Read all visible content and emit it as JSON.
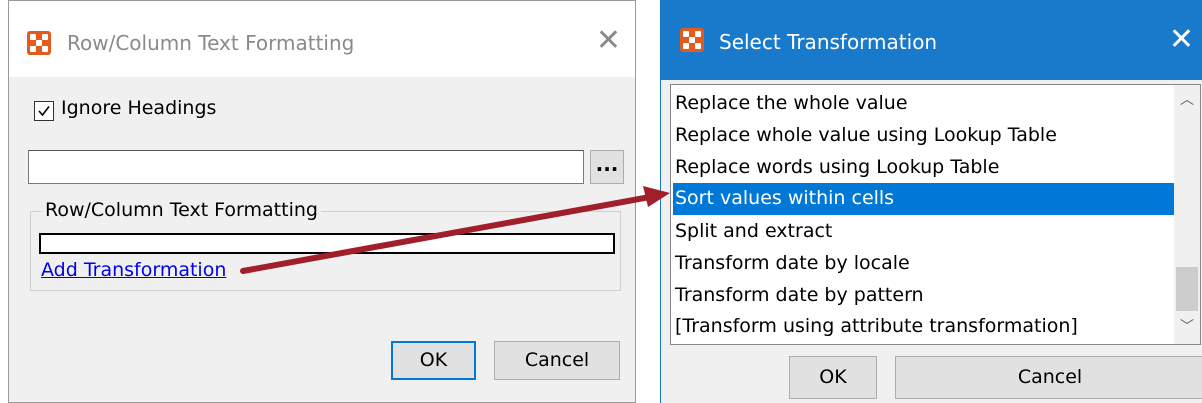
{
  "left_dialog": {
    "title": "Row/Column Text Formatting",
    "close_glyph": "✕",
    "ignore_headings": {
      "label": "Ignore Headings",
      "checked": true
    },
    "path_field": {
      "value": ""
    },
    "browse_label": "...",
    "group": {
      "legend": "Row/Column Text Formatting",
      "add_transformation_label": "Add Transformation"
    },
    "ok_label": "OK",
    "cancel_label": "Cancel"
  },
  "right_dialog": {
    "title": "Select Transformation",
    "close_glyph": "✕",
    "items": [
      {
        "label": "Replace the whole value",
        "selected": false
      },
      {
        "label": "Replace whole value using Lookup Table",
        "selected": false
      },
      {
        "label": "Replace words using Lookup Table",
        "selected": false
      },
      {
        "label": "Sort values within cells",
        "selected": true
      },
      {
        "label": "Split and extract",
        "selected": false
      },
      {
        "label": "Transform date by locale",
        "selected": false
      },
      {
        "label": "Transform date by pattern",
        "selected": false
      },
      {
        "label": "[Transform using attribute transformation]",
        "selected": false
      }
    ],
    "scroll_up_glyph": "︿",
    "scroll_down_glyph": "﹀",
    "ok_label": "OK",
    "cancel_label": "Cancel"
  },
  "colors": {
    "accent": "#1979ca",
    "selection": "#0078d7",
    "arrow": "#a11f2b",
    "app_icon": "#e35b1e",
    "link": "#0000ee"
  }
}
